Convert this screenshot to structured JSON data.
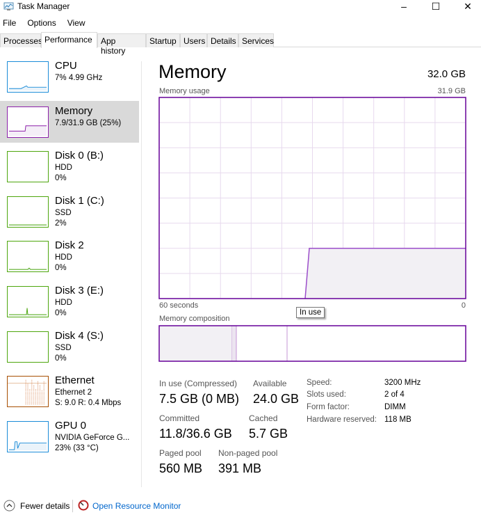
{
  "window": {
    "title": "Task Manager",
    "minimize": "–",
    "maximize": "☐",
    "close": "✕"
  },
  "menu": [
    "File",
    "Options",
    "View"
  ],
  "tabs": [
    "Processes",
    "Performance",
    "App history",
    "Startup",
    "Users",
    "Details",
    "Services"
  ],
  "active_tab": "Performance",
  "sidebar": [
    {
      "name": "CPU",
      "line2": "7% 4.99 GHz",
      "line3": "",
      "color": "#1a8cd8"
    },
    {
      "name": "Memory",
      "line2": "7.9/31.9 GB (25%)",
      "line3": "",
      "color": "#8b1fa9"
    },
    {
      "name": "Disk 0 (B:)",
      "line2": "HDD",
      "line3": "0%",
      "color": "#4da60c"
    },
    {
      "name": "Disk 1 (C:)",
      "line2": "SSD",
      "line3": "2%",
      "color": "#4da60c"
    },
    {
      "name": "Disk 2",
      "line2": "HDD",
      "line3": "0%",
      "color": "#4da60c"
    },
    {
      "name": "Disk 3 (E:)",
      "line2": "HDD",
      "line3": "0%",
      "color": "#4da60c"
    },
    {
      "name": "Disk 4 (S:)",
      "line2": "SSD",
      "line3": "0%",
      "color": "#4da60c"
    },
    {
      "name": "Ethernet",
      "line2": "Ethernet 2",
      "line3": "S: 9.0 R: 0.4 Mbps",
      "color": "#a74f01"
    },
    {
      "name": "GPU 0",
      "line2": "NVIDIA GeForce G...",
      "line3": "23% (33 °C)",
      "color": "#1a8cd8"
    }
  ],
  "main": {
    "title": "Memory",
    "total": "32.0 GB",
    "usage_label": "Memory usage",
    "usage_max": "31.9 GB",
    "x_left": "60 seconds",
    "x_right": "0",
    "usage_fraction": 0.25,
    "composition_label": "Memory composition",
    "tooltip": "In use",
    "stats": {
      "in_use_label": "In use (Compressed)",
      "in_use": "7.5 GB (0 MB)",
      "available_label": "Available",
      "available": "24.0 GB",
      "committed_label": "Committed",
      "committed": "11.8/36.6 GB",
      "cached_label": "Cached",
      "cached": "5.7 GB",
      "paged_label": "Paged pool",
      "paged": "560 MB",
      "nonpaged_label": "Non-paged pool",
      "nonpaged": "391 MB"
    },
    "details": [
      {
        "label": "Speed:",
        "value": "3200 MHz"
      },
      {
        "label": "Slots used:",
        "value": "2 of 4"
      },
      {
        "label": "Form factor:",
        "value": "DIMM"
      },
      {
        "label": "Hardware reserved:",
        "value": "118 MB"
      }
    ],
    "accent": "#660099"
  },
  "footer": {
    "fewer": "Fewer details",
    "monitor": "Open Resource Monitor"
  }
}
